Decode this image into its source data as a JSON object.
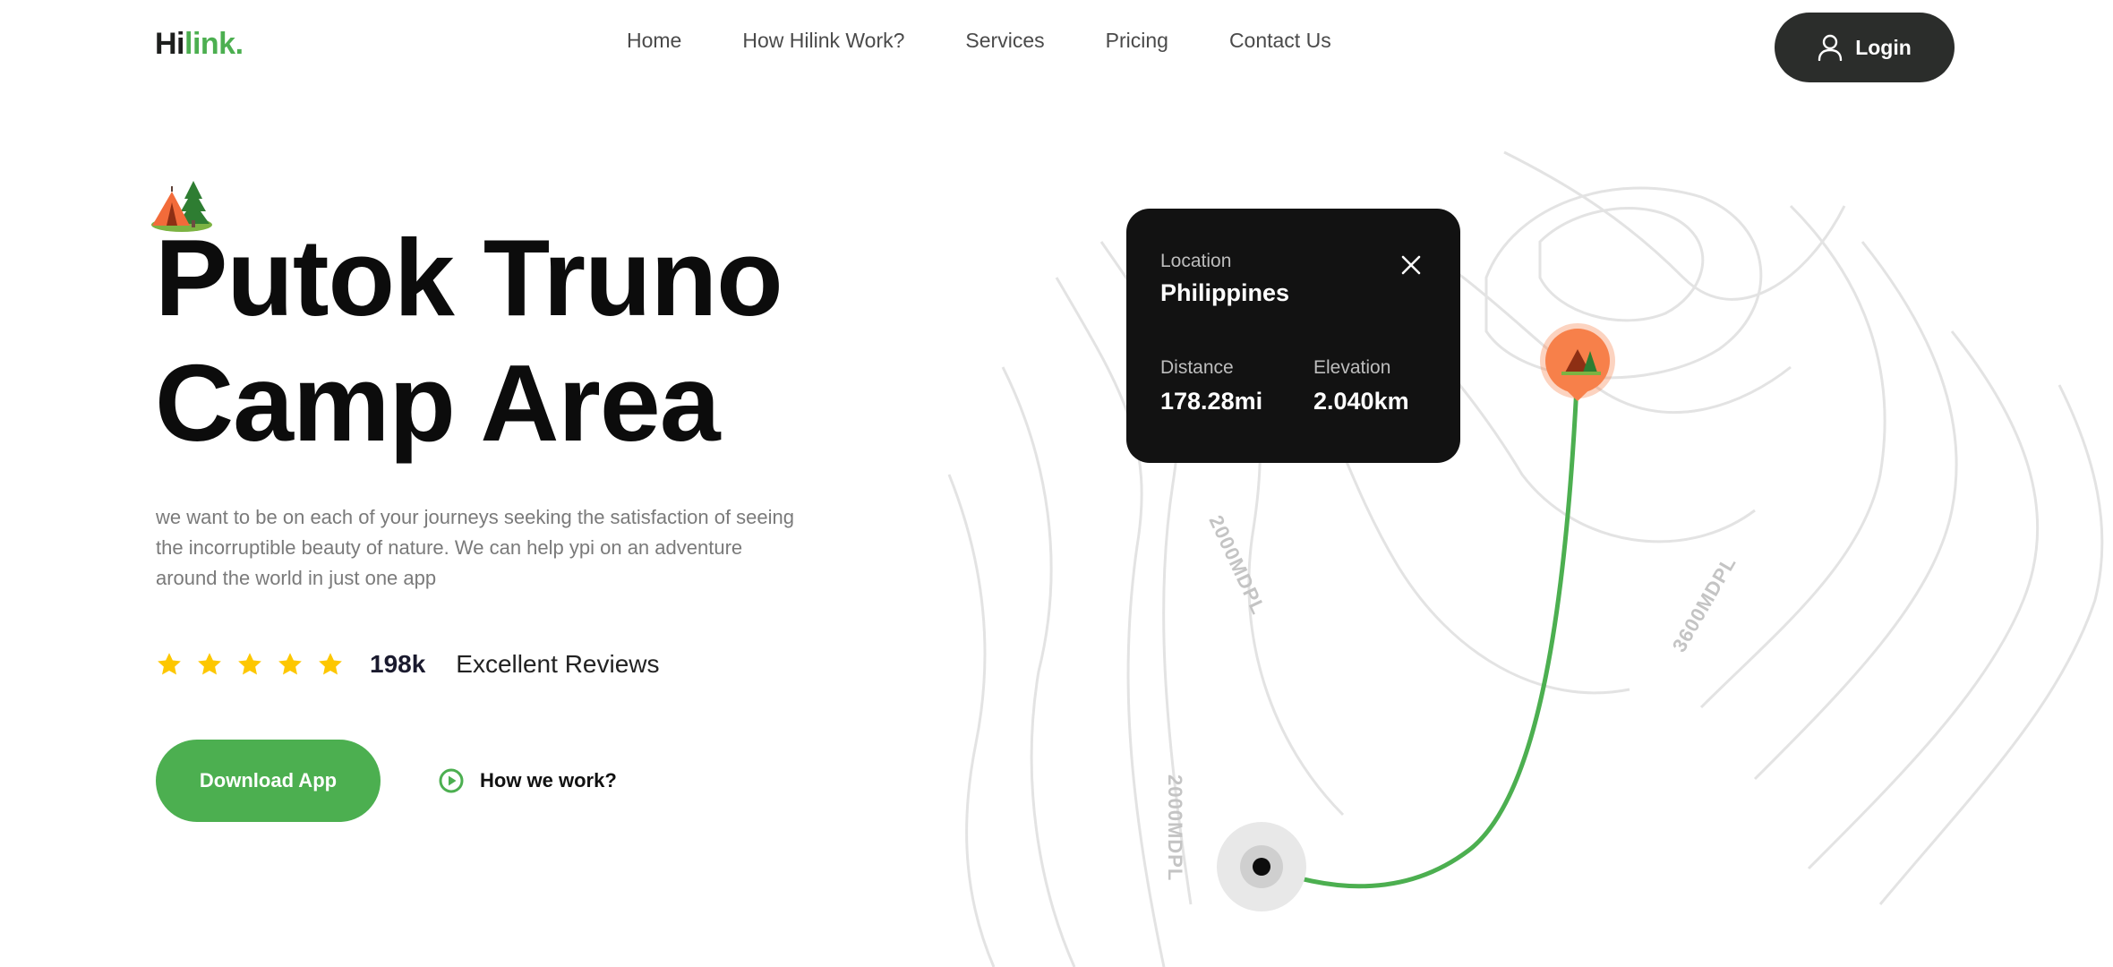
{
  "brand": {
    "name_part1": "Hi",
    "name_part2": "link",
    "name_dot": ".",
    "accent": "#4caf50",
    "dark": "#2b2d2b"
  },
  "nav": {
    "items": [
      {
        "label": "Home"
      },
      {
        "label": "How Hilink Work?"
      },
      {
        "label": "Services"
      },
      {
        "label": "Pricing"
      },
      {
        "label": "Contact Us"
      }
    ],
    "login_label": "Login",
    "login_icon": "user-icon"
  },
  "hero": {
    "badge_icon": "tent-icon",
    "title_line1": "Putok Truno",
    "title_line2": "Camp Area",
    "description": "we want to be on each of your journeys seeking the satisfaction of seeing the incorruptible beauty of nature. We can help ypi on an adventure around the world in just one app",
    "rating": {
      "stars": 5,
      "count": "198k",
      "label": "Excellent Reviews",
      "star_color": "#fdc700"
    },
    "download_label": "Download App",
    "how_label": "How we work?",
    "how_icon": "play-icon"
  },
  "map": {
    "contour_labels": [
      "2000MDPL",
      "3600MDPL",
      "2000MDPL"
    ],
    "route_color": "#4caf50",
    "pin_color": "#f7804a",
    "pin_icon": "tent-icon",
    "start_icon": "location-dot-icon"
  },
  "card": {
    "location_label": "Location",
    "location_value": "Philippines",
    "distance_label": "Distance",
    "distance_value": "178.28mi",
    "elevation_label": "Elevation",
    "elevation_value": "2.040km",
    "close_icon": "close-icon"
  }
}
